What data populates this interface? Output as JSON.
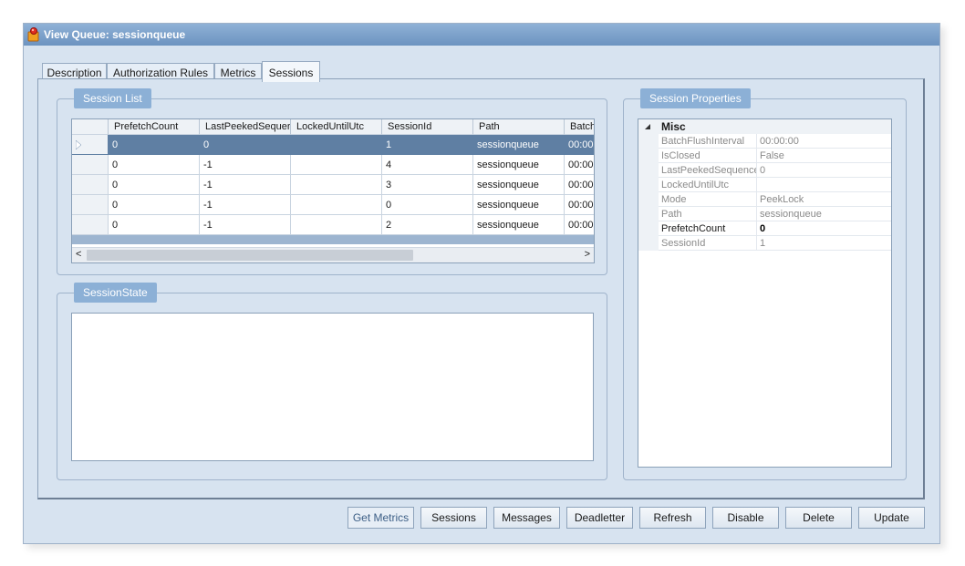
{
  "window": {
    "title": "View Queue: sessionqueue"
  },
  "tabs": [
    "Description",
    "Authorization Rules",
    "Metrics",
    "Sessions"
  ],
  "active_tab": "Sessions",
  "session_list": {
    "title": "Session List",
    "columns": [
      "PrefetchCount",
      "LastPeekedSequer",
      "LockedUntilUtc",
      "SessionId",
      "Path",
      "Batch"
    ],
    "rows": [
      [
        "0",
        "0",
        "",
        "1",
        "sessionqueue",
        "00:00:"
      ],
      [
        "0",
        "-1",
        "",
        "4",
        "sessionqueue",
        "00:00:"
      ],
      [
        "0",
        "-1",
        "",
        "3",
        "sessionqueue",
        "00:00:"
      ],
      [
        "0",
        "-1",
        "",
        "0",
        "sessionqueue",
        "00:00:"
      ],
      [
        "0",
        "-1",
        "",
        "2",
        "sessionqueue",
        "00:00:"
      ]
    ],
    "selected_row": 0,
    "scroll_left_glyph": "<",
    "scroll_right_glyph": ">"
  },
  "session_state": {
    "title": "SessionState"
  },
  "session_properties": {
    "title": "Session Properties",
    "category": "Misc",
    "rows": [
      {
        "name": "BatchFlushInterval",
        "value": "00:00:00",
        "bold": false
      },
      {
        "name": "IsClosed",
        "value": "False",
        "bold": false
      },
      {
        "name": "LastPeekedSequence",
        "value": "0",
        "bold": false
      },
      {
        "name": "LockedUntilUtc",
        "value": "",
        "bold": false
      },
      {
        "name": "Mode",
        "value": "PeekLock",
        "bold": false
      },
      {
        "name": "Path",
        "value": "sessionqueue",
        "bold": false
      },
      {
        "name": "PrefetchCount",
        "value": "0",
        "bold": true
      },
      {
        "name": "SessionId",
        "value": "1",
        "bold": false
      }
    ]
  },
  "buttons": {
    "get_metrics": "Get Metrics",
    "sessions": "Sessions",
    "messages": "Messages",
    "deadletter": "Deadletter",
    "refresh": "Refresh",
    "disable": "Disable",
    "delete": "Delete",
    "update": "Update"
  },
  "colors": {
    "background": "#d7e3f0",
    "accent": "#8cb0d6",
    "selection": "#5f7fa3"
  },
  "icons": {
    "app": "queue-app-icon",
    "collapse": "collapse-triangle-icon",
    "row_pointer": "row-pointer-icon"
  }
}
